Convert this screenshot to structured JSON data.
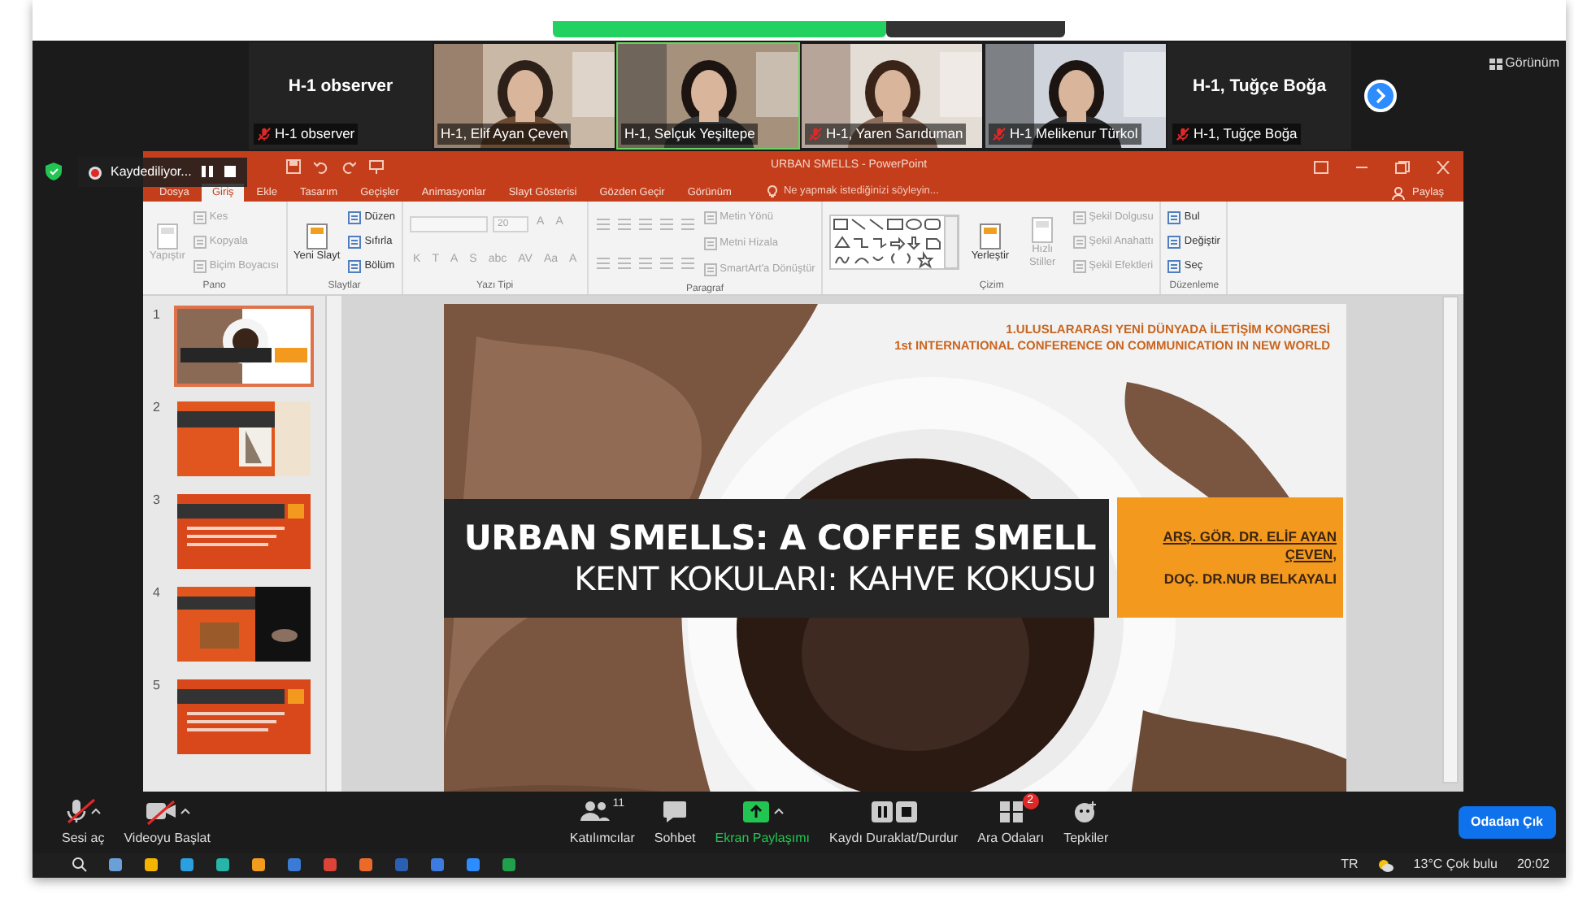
{
  "participants": [
    {
      "kind": "name_tile",
      "title": "H-1 observer",
      "name": "H-1 observer",
      "muted": true,
      "speaking": false
    },
    {
      "kind": "video",
      "name": "H-1, Elif Ayan Çeven",
      "muted": false,
      "speaking": false
    },
    {
      "kind": "video",
      "name": "H-1, Selçuk Yeşiltepe",
      "muted": false,
      "speaking": true
    },
    {
      "kind": "video",
      "name": "H-1, Yaren Sarıduman",
      "muted": true,
      "speaking": false
    },
    {
      "kind": "video",
      "name": "H-1 Melikenur Türkol",
      "muted": true,
      "speaking": false
    },
    {
      "kind": "name_tile",
      "title": "H-1, Tuğçe Boğa",
      "name": "H-1, Tuğçe Boğa",
      "muted": true,
      "speaking": false
    }
  ],
  "view_button": "Görünüm",
  "recording": {
    "label": "Kaydediliyor..."
  },
  "powerpoint": {
    "title": "URBAN SMELLS - PowerPoint",
    "tabs": [
      {
        "label": "Dosya",
        "selected": false
      },
      {
        "label": "Giriş",
        "selected": true
      },
      {
        "label": "Ekle",
        "selected": false
      },
      {
        "label": "Tasarım",
        "selected": false
      },
      {
        "label": "Geçişler",
        "selected": false
      },
      {
        "label": "Animasyonlar",
        "selected": false
      },
      {
        "label": "Slayt Gösterisi",
        "selected": false
      },
      {
        "label": "Gözden Geçir",
        "selected": false
      },
      {
        "label": "Görünüm",
        "selected": false
      }
    ],
    "tell_me": "Ne yapmak istediğinizi söyleyin...",
    "share": "Paylaş",
    "ribbon": [
      {
        "label": "Pano",
        "columns": [
          [
            {
              "kind": "large",
              "label": "Yapıştır",
              "disabled": true
            }
          ],
          [
            {
              "kind": "small",
              "label": "Kes",
              "disabled": true
            },
            {
              "kind": "small",
              "label": "Kopyala",
              "disabled": true
            },
            {
              "kind": "small",
              "label": "Biçim Boyacısı",
              "disabled": true
            }
          ]
        ]
      },
      {
        "label": "Slaytlar",
        "columns": [
          [
            {
              "kind": "large",
              "label": "Yeni Slayt",
              "disabled": false
            }
          ],
          [
            {
              "kind": "small",
              "label": "Düzen",
              "disabled": false
            },
            {
              "kind": "small",
              "label": "Sıfırla",
              "disabled": false
            },
            {
              "kind": "small",
              "label": "Bölüm",
              "disabled": false
            }
          ]
        ]
      },
      {
        "label": "Yazı Tipi",
        "columns": [
          [
            {
              "kind": "line",
              "items": [
                {
                  "kind": "field",
                  "disabled": true
                },
                {
                  "kind": "field",
                  "value": "20",
                  "disabled": true
                },
                {
                  "kind": "glyph",
                  "label": "A",
                  "disabled": true
                },
                {
                  "kind": "glyph",
                  "label": "A",
                  "disabled": true
                }
              ]
            },
            {
              "kind": "line",
              "items": [
                {
                  "kind": "glyph",
                  "label": "K",
                  "disabled": true
                },
                {
                  "kind": "glyph",
                  "label": "T",
                  "disabled": true
                },
                {
                  "kind": "glyph",
                  "label": "A",
                  "disabled": true
                },
                {
                  "kind": "glyph",
                  "label": "S",
                  "disabled": true
                },
                {
                  "kind": "glyph",
                  "label": "abc",
                  "disabled": true
                },
                {
                  "kind": "glyph",
                  "label": "AV",
                  "disabled": true
                },
                {
                  "kind": "glyph",
                  "label": "Aa",
                  "disabled": true
                },
                {
                  "kind": "glyph",
                  "label": "A",
                  "disabled": true
                }
              ]
            }
          ]
        ]
      },
      {
        "label": "Paragraf",
        "columns": [
          [
            {
              "kind": "line",
              "items": [
                {
                  "kind": "icon",
                  "disabled": true
                },
                {
                  "kind": "icon",
                  "disabled": true
                },
                {
                  "kind": "icon",
                  "disabled": true
                },
                {
                  "kind": "icon",
                  "disabled": true
                },
                {
                  "kind": "icon",
                  "disabled": true
                }
              ]
            },
            {
              "kind": "line",
              "items": [
                {
                  "kind": "icon",
                  "disabled": true
                },
                {
                  "kind": "icon",
                  "disabled": true
                },
                {
                  "kind": "icon",
                  "disabled": true
                },
                {
                  "kind": "icon",
                  "disabled": true
                },
                {
                  "kind": "icon",
                  "disabled": true
                }
              ]
            }
          ],
          [
            {
              "kind": "small",
              "label": "Metin Yönü",
              "disabled": true
            },
            {
              "kind": "small",
              "label": "Metni Hizala",
              "disabled": true
            },
            {
              "kind": "small",
              "label": "SmartArt'a Dönüştür",
              "disabled": true
            }
          ]
        ]
      },
      {
        "label": "Çizim",
        "columns": [
          [
            {
              "kind": "gallery",
              "disabled": false
            }
          ],
          [
            {
              "kind": "large",
              "label": "Yerleştir",
              "disabled": false
            }
          ],
          [
            {
              "kind": "large",
              "label": "Hızlı Stiller",
              "disabled": true
            }
          ],
          [
            {
              "kind": "small",
              "label": "Şekil Dolgusu",
              "disabled": true
            },
            {
              "kind": "small",
              "label": "Şekil Anahattı",
              "disabled": true
            },
            {
              "kind": "small",
              "label": "Şekil Efektleri",
              "disabled": true
            }
          ]
        ]
      },
      {
        "label": "Düzenleme",
        "columns": [
          [
            {
              "kind": "small",
              "label": "Bul",
              "disabled": false
            },
            {
              "kind": "small",
              "label": "Değiştir",
              "disabled": false
            },
            {
              "kind": "small",
              "label": "Seç",
              "disabled": false
            }
          ]
        ]
      }
    ],
    "slides": [
      {
        "number": "1",
        "selected": true
      },
      {
        "number": "2",
        "selected": false
      },
      {
        "number": "3",
        "selected": false
      },
      {
        "number": "4",
        "selected": false
      },
      {
        "number": "5",
        "selected": false
      }
    ],
    "slide": {
      "conference_tr": "1.ULUSLARARASI YENİ DÜNYADA İLETİŞİM KONGRESİ",
      "conference_en": "1st INTERNATIONAL CONFERENCE ON COMMUNICATION IN NEW WORLD",
      "title": "URBAN SMELLS: A COFFEE SMELL",
      "subtitle": "KENT KOKULARI: KAHVE KOKUSU",
      "authors": [
        {
          "text": "ARŞ. GÖR. DR. ELİF AYAN ÇEVEN,",
          "underlined": true
        },
        {
          "text": "DOÇ. DR.NUR BELKAYALI",
          "underlined": false
        }
      ]
    }
  },
  "toolbar": [
    {
      "kind": "mic",
      "label": "Sesi aç",
      "off": true,
      "menu": true
    },
    {
      "kind": "video",
      "label": "Videoyu Başlat",
      "off": true,
      "menu": true
    },
    {
      "kind": "participants",
      "label": "Katılımcılar",
      "count": "11"
    },
    {
      "kind": "chat",
      "label": "Sohbet"
    },
    {
      "kind": "share",
      "label": "Ekran Paylaşımı",
      "menu": true
    },
    {
      "kind": "record",
      "label": "Kaydı Duraklat/Durdur"
    },
    {
      "kind": "rooms",
      "label": "Ara Odaları",
      "count": "2"
    },
    {
      "kind": "reactions",
      "label": "Tepkiler"
    }
  ],
  "leave_button": "Odadan Çık",
  "taskbar": {
    "language": "TR",
    "weather": "13°C Çok bulu",
    "time": "20:02"
  }
}
